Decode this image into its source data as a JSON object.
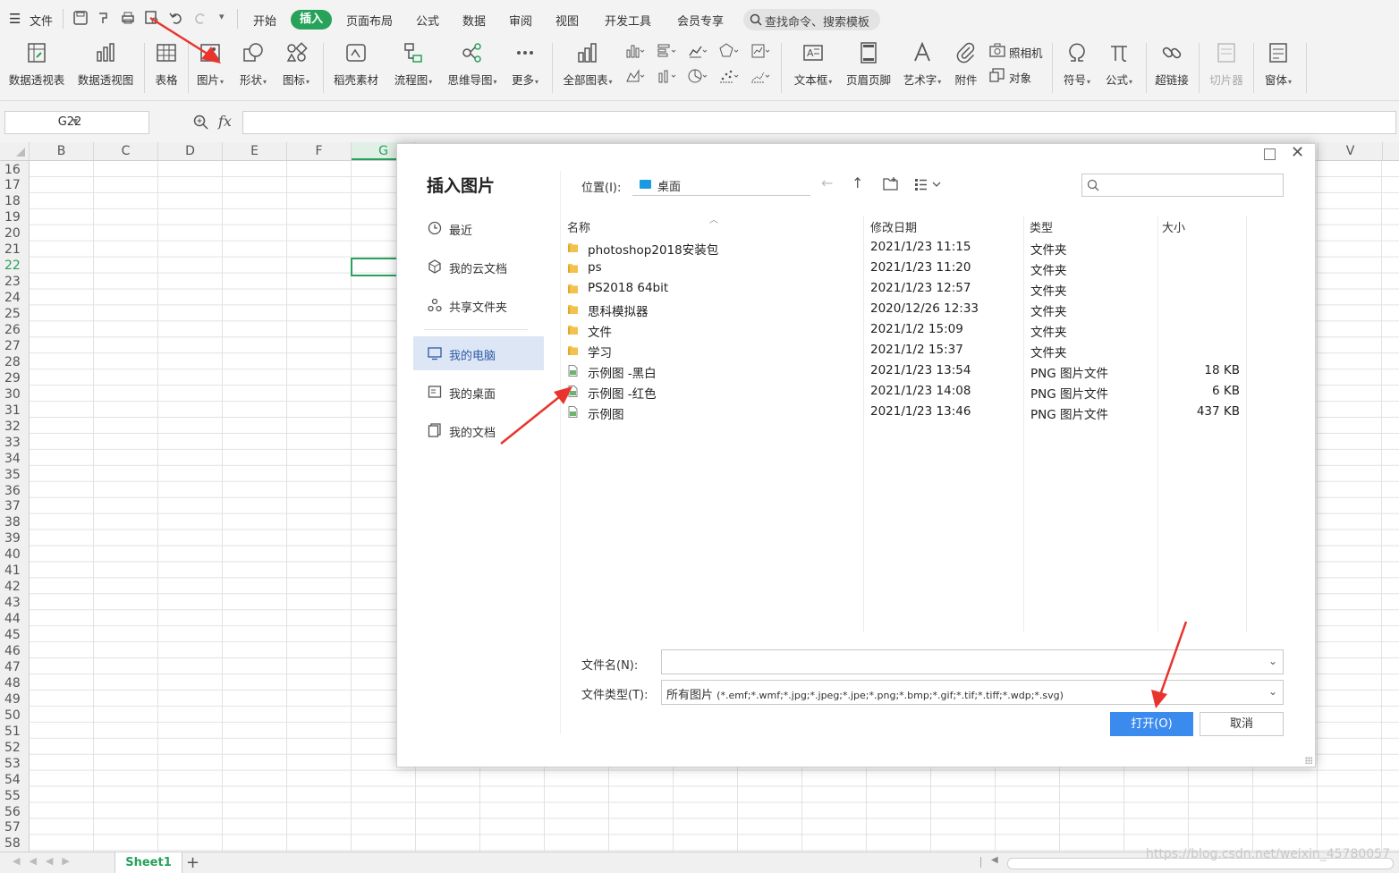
{
  "menu": {
    "file_label": "文件",
    "tabs": [
      "开始",
      "插入",
      "页面布局",
      "公式",
      "数据",
      "审阅",
      "视图",
      "开发工具",
      "会员专享"
    ],
    "search_placeholder": "查找命令、搜索模板"
  },
  "ribbon": {
    "pivot_table": "数据透视表",
    "pivot_chart": "数据透视图",
    "table": "表格",
    "picture": "图片",
    "shape": "形状",
    "icon": "图标",
    "daoke": "稻壳素材",
    "flowchart": "流程图",
    "mindmap": "思维导图",
    "more": "更多",
    "all_charts": "全部图表",
    "textbox": "文本框",
    "header_footer": "页眉页脚",
    "wordart": "艺术字",
    "attachment": "附件",
    "camera": "照相机",
    "object": "对象",
    "symbol": "符号",
    "formula": "公式",
    "hyperlink": "超链接",
    "slicer": "切片器",
    "window": "窗体"
  },
  "formula_bar": {
    "name_box": "G22",
    "fx_label": "fx"
  },
  "sheet": {
    "columns": [
      "B",
      "C",
      "D",
      "E",
      "F",
      "G",
      "V"
    ],
    "rows": [
      "16",
      "17",
      "18",
      "19",
      "20",
      "21",
      "22",
      "23",
      "24",
      "25",
      "26",
      "27",
      "28",
      "29",
      "30",
      "31",
      "32",
      "33",
      "34",
      "35",
      "36",
      "37",
      "38",
      "39",
      "40",
      "41",
      "42",
      "43",
      "44",
      "45",
      "46",
      "47",
      "48",
      "49",
      "50",
      "51",
      "52",
      "53",
      "54",
      "55",
      "56",
      "57",
      "58"
    ],
    "active_row": "22",
    "sheet_tab": "Sheet1",
    "watermark": "https://blog.csdn.net/weixin_45780057"
  },
  "dialog": {
    "title": "插入图片",
    "nav": [
      "最近",
      "我的云文档",
      "共享文件夹",
      "我的电脑",
      "我的桌面",
      "我的文档"
    ],
    "nav_active": "我的电脑",
    "location_label": "位置(I):",
    "location_value": "桌面",
    "columns": {
      "name": "名称",
      "date": "修改日期",
      "type": "类型",
      "size": "大小"
    },
    "files": [
      {
        "name": "photoshop2018安装包",
        "date": "2021/1/23 11:15",
        "type": "文件夹",
        "size": "",
        "kind": "folder"
      },
      {
        "name": "ps",
        "date": "2021/1/23 11:20",
        "type": "文件夹",
        "size": "",
        "kind": "folder"
      },
      {
        "name": "PS2018 64bit",
        "date": "2021/1/23 12:57",
        "type": "文件夹",
        "size": "",
        "kind": "folder"
      },
      {
        "name": "思科模拟器",
        "date": "2020/12/26 12:33",
        "type": "文件夹",
        "size": "",
        "kind": "folder"
      },
      {
        "name": "文件",
        "date": "2021/1/2 15:09",
        "type": "文件夹",
        "size": "",
        "kind": "folder"
      },
      {
        "name": "学习",
        "date": "2021/1/2 15:37",
        "type": "文件夹",
        "size": "",
        "kind": "folder"
      },
      {
        "name": "示例图 -黑白",
        "date": "2021/1/23 13:54",
        "type": "PNG 图片文件",
        "size": "18 KB",
        "kind": "png"
      },
      {
        "name": "示例图 -红色",
        "date": "2021/1/23 14:08",
        "type": "PNG 图片文件",
        "size": "6 KB",
        "kind": "png"
      },
      {
        "name": "示例图",
        "date": "2021/1/23 13:46",
        "type": "PNG 图片文件",
        "size": "437 KB",
        "kind": "png"
      }
    ],
    "filename_label": "文件名(N):",
    "filename_value": "",
    "filetype_label": "文件类型(T):",
    "filetype_main": "所有图片",
    "filetype_ext": "(*.emf;*.wmf;*.jpg;*.jpeg;*.jpe;*.png;*.bmp;*.gif;*.tif;*.tiff;*.wdp;*.svg)",
    "open_button": "打开(O)",
    "cancel_button": "取消"
  },
  "colors": {
    "accent_green": "#26a25a",
    "primary_blue": "#3b8bef",
    "annotation_red": "#e8342c",
    "folder_yellow": "#f2c14e"
  }
}
